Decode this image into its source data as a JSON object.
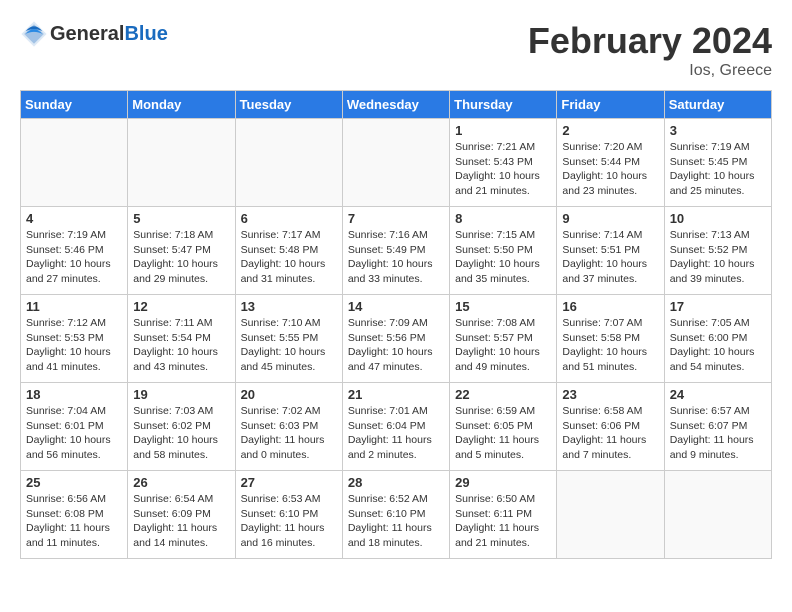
{
  "header": {
    "logo_general": "General",
    "logo_blue": "Blue",
    "month": "February 2024",
    "location": "Ios, Greece"
  },
  "weekdays": [
    "Sunday",
    "Monday",
    "Tuesday",
    "Wednesday",
    "Thursday",
    "Friday",
    "Saturday"
  ],
  "weeks": [
    [
      {
        "day": "",
        "info": ""
      },
      {
        "day": "",
        "info": ""
      },
      {
        "day": "",
        "info": ""
      },
      {
        "day": "",
        "info": ""
      },
      {
        "day": "1",
        "info": "Sunrise: 7:21 AM\nSunset: 5:43 PM\nDaylight: 10 hours\nand 21 minutes."
      },
      {
        "day": "2",
        "info": "Sunrise: 7:20 AM\nSunset: 5:44 PM\nDaylight: 10 hours\nand 23 minutes."
      },
      {
        "day": "3",
        "info": "Sunrise: 7:19 AM\nSunset: 5:45 PM\nDaylight: 10 hours\nand 25 minutes."
      }
    ],
    [
      {
        "day": "4",
        "info": "Sunrise: 7:19 AM\nSunset: 5:46 PM\nDaylight: 10 hours\nand 27 minutes."
      },
      {
        "day": "5",
        "info": "Sunrise: 7:18 AM\nSunset: 5:47 PM\nDaylight: 10 hours\nand 29 minutes."
      },
      {
        "day": "6",
        "info": "Sunrise: 7:17 AM\nSunset: 5:48 PM\nDaylight: 10 hours\nand 31 minutes."
      },
      {
        "day": "7",
        "info": "Sunrise: 7:16 AM\nSunset: 5:49 PM\nDaylight: 10 hours\nand 33 minutes."
      },
      {
        "day": "8",
        "info": "Sunrise: 7:15 AM\nSunset: 5:50 PM\nDaylight: 10 hours\nand 35 minutes."
      },
      {
        "day": "9",
        "info": "Sunrise: 7:14 AM\nSunset: 5:51 PM\nDaylight: 10 hours\nand 37 minutes."
      },
      {
        "day": "10",
        "info": "Sunrise: 7:13 AM\nSunset: 5:52 PM\nDaylight: 10 hours\nand 39 minutes."
      }
    ],
    [
      {
        "day": "11",
        "info": "Sunrise: 7:12 AM\nSunset: 5:53 PM\nDaylight: 10 hours\nand 41 minutes."
      },
      {
        "day": "12",
        "info": "Sunrise: 7:11 AM\nSunset: 5:54 PM\nDaylight: 10 hours\nand 43 minutes."
      },
      {
        "day": "13",
        "info": "Sunrise: 7:10 AM\nSunset: 5:55 PM\nDaylight: 10 hours\nand 45 minutes."
      },
      {
        "day": "14",
        "info": "Sunrise: 7:09 AM\nSunset: 5:56 PM\nDaylight: 10 hours\nand 47 minutes."
      },
      {
        "day": "15",
        "info": "Sunrise: 7:08 AM\nSunset: 5:57 PM\nDaylight: 10 hours\nand 49 minutes."
      },
      {
        "day": "16",
        "info": "Sunrise: 7:07 AM\nSunset: 5:58 PM\nDaylight: 10 hours\nand 51 minutes."
      },
      {
        "day": "17",
        "info": "Sunrise: 7:05 AM\nSunset: 6:00 PM\nDaylight: 10 hours\nand 54 minutes."
      }
    ],
    [
      {
        "day": "18",
        "info": "Sunrise: 7:04 AM\nSunset: 6:01 PM\nDaylight: 10 hours\nand 56 minutes."
      },
      {
        "day": "19",
        "info": "Sunrise: 7:03 AM\nSunset: 6:02 PM\nDaylight: 10 hours\nand 58 minutes."
      },
      {
        "day": "20",
        "info": "Sunrise: 7:02 AM\nSunset: 6:03 PM\nDaylight: 11 hours\nand 0 minutes."
      },
      {
        "day": "21",
        "info": "Sunrise: 7:01 AM\nSunset: 6:04 PM\nDaylight: 11 hours\nand 2 minutes."
      },
      {
        "day": "22",
        "info": "Sunrise: 6:59 AM\nSunset: 6:05 PM\nDaylight: 11 hours\nand 5 minutes."
      },
      {
        "day": "23",
        "info": "Sunrise: 6:58 AM\nSunset: 6:06 PM\nDaylight: 11 hours\nand 7 minutes."
      },
      {
        "day": "24",
        "info": "Sunrise: 6:57 AM\nSunset: 6:07 PM\nDaylight: 11 hours\nand 9 minutes."
      }
    ],
    [
      {
        "day": "25",
        "info": "Sunrise: 6:56 AM\nSunset: 6:08 PM\nDaylight: 11 hours\nand 11 minutes."
      },
      {
        "day": "26",
        "info": "Sunrise: 6:54 AM\nSunset: 6:09 PM\nDaylight: 11 hours\nand 14 minutes."
      },
      {
        "day": "27",
        "info": "Sunrise: 6:53 AM\nSunset: 6:10 PM\nDaylight: 11 hours\nand 16 minutes."
      },
      {
        "day": "28",
        "info": "Sunrise: 6:52 AM\nSunset: 6:10 PM\nDaylight: 11 hours\nand 18 minutes."
      },
      {
        "day": "29",
        "info": "Sunrise: 6:50 AM\nSunset: 6:11 PM\nDaylight: 11 hours\nand 21 minutes."
      },
      {
        "day": "",
        "info": ""
      },
      {
        "day": "",
        "info": ""
      }
    ]
  ]
}
